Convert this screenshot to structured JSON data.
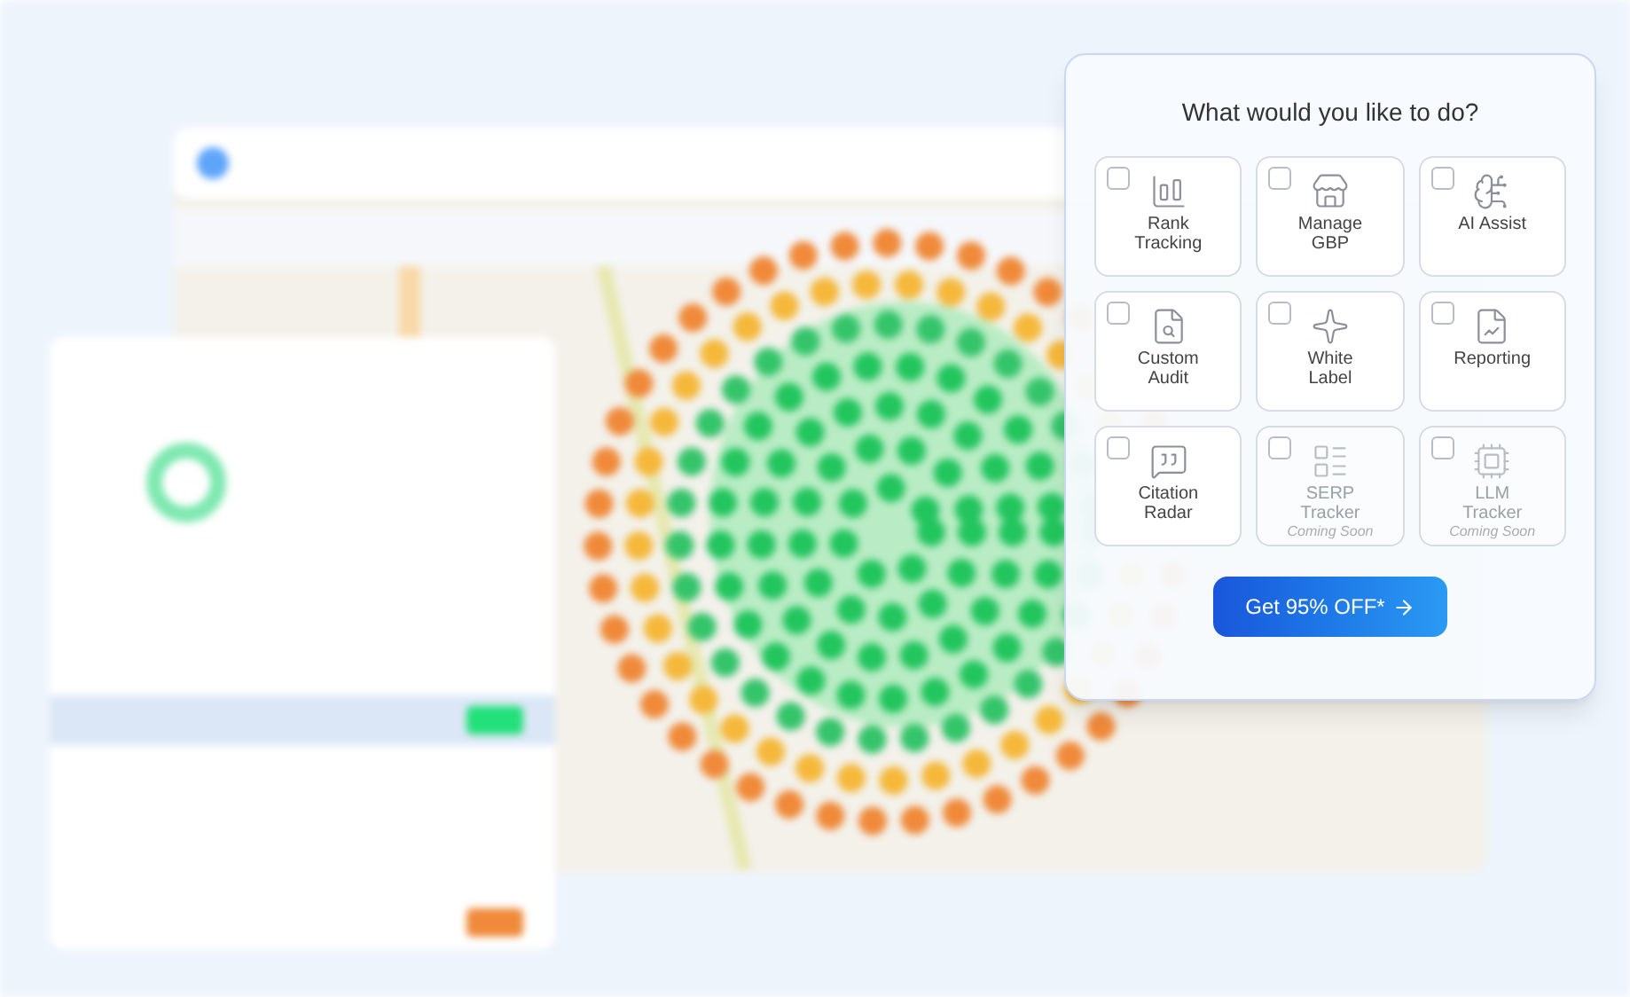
{
  "dialog": {
    "title": "What would you like to do?",
    "options": [
      {
        "label": "Rank Tracking",
        "checked": false,
        "disabled": false
      },
      {
        "label": "Manage GBP",
        "checked": false,
        "disabled": false
      },
      {
        "label": "AI Assist",
        "checked": false,
        "disabled": false
      },
      {
        "label": "Custom Audit",
        "checked": false,
        "disabled": false
      },
      {
        "label": "White Label",
        "checked": false,
        "disabled": false
      },
      {
        "label": "Reporting",
        "checked": false,
        "disabled": false
      },
      {
        "label": "Citation Radar",
        "checked": false,
        "disabled": false
      },
      {
        "label": "SERP Tracker",
        "note": "Coming Soon",
        "checked": false,
        "disabled": true
      },
      {
        "label": "LLM Tracker",
        "note": "Coming Soon",
        "checked": false,
        "disabled": true
      }
    ],
    "button": {
      "label": "Get 95% OFF*"
    }
  }
}
